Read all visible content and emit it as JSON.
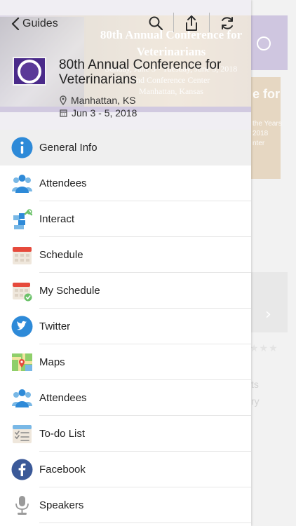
{
  "header": {
    "back_label": "Guides",
    "title": "80th Annual Conference for Veterinarians",
    "location": "Manhattan, KS",
    "dates": "Jun 3 - 5, 2018",
    "banner": {
      "title": "80th Annual Conference for Veterinarians",
      "subtitle_line1": "Sunday, June 3 - Tuesday, June 5, 2018",
      "subtitle_line2": "and Conference Center",
      "subtitle_line3": "Manhattan, Kansas"
    },
    "icons": [
      "search-icon",
      "share-icon",
      "refresh-icon"
    ]
  },
  "menu": {
    "items": [
      {
        "label": "General Info",
        "icon": "info-icon",
        "active": true
      },
      {
        "label": "Attendees",
        "icon": "attendees-icon",
        "active": false
      },
      {
        "label": "Interact",
        "icon": "interact-icon",
        "active": false
      },
      {
        "label": "Schedule",
        "icon": "calendar-icon",
        "active": false
      },
      {
        "label": "My Schedule",
        "icon": "my-schedule-icon",
        "active": false
      },
      {
        "label": "Twitter",
        "icon": "twitter-icon",
        "active": false
      },
      {
        "label": "Maps",
        "icon": "map-icon",
        "active": false
      },
      {
        "label": "Attendees",
        "icon": "attendees-icon",
        "active": false
      },
      {
        "label": "To-do List",
        "icon": "todo-icon",
        "active": false
      },
      {
        "label": "Facebook",
        "icon": "facebook-icon",
        "active": false
      },
      {
        "label": "Speakers",
        "icon": "microphone-icon",
        "active": false
      }
    ]
  },
  "background": {
    "banner_text": "e for",
    "banner_small": "the Years\n2018\nnter",
    "text1": "ts",
    "text2": "ry"
  },
  "colors": {
    "blue": "#2e8ad8",
    "purple": "#4a2a8a",
    "facebook": "#3b5998",
    "twitter": "#1da1f2",
    "active_row": "#efefef"
  }
}
